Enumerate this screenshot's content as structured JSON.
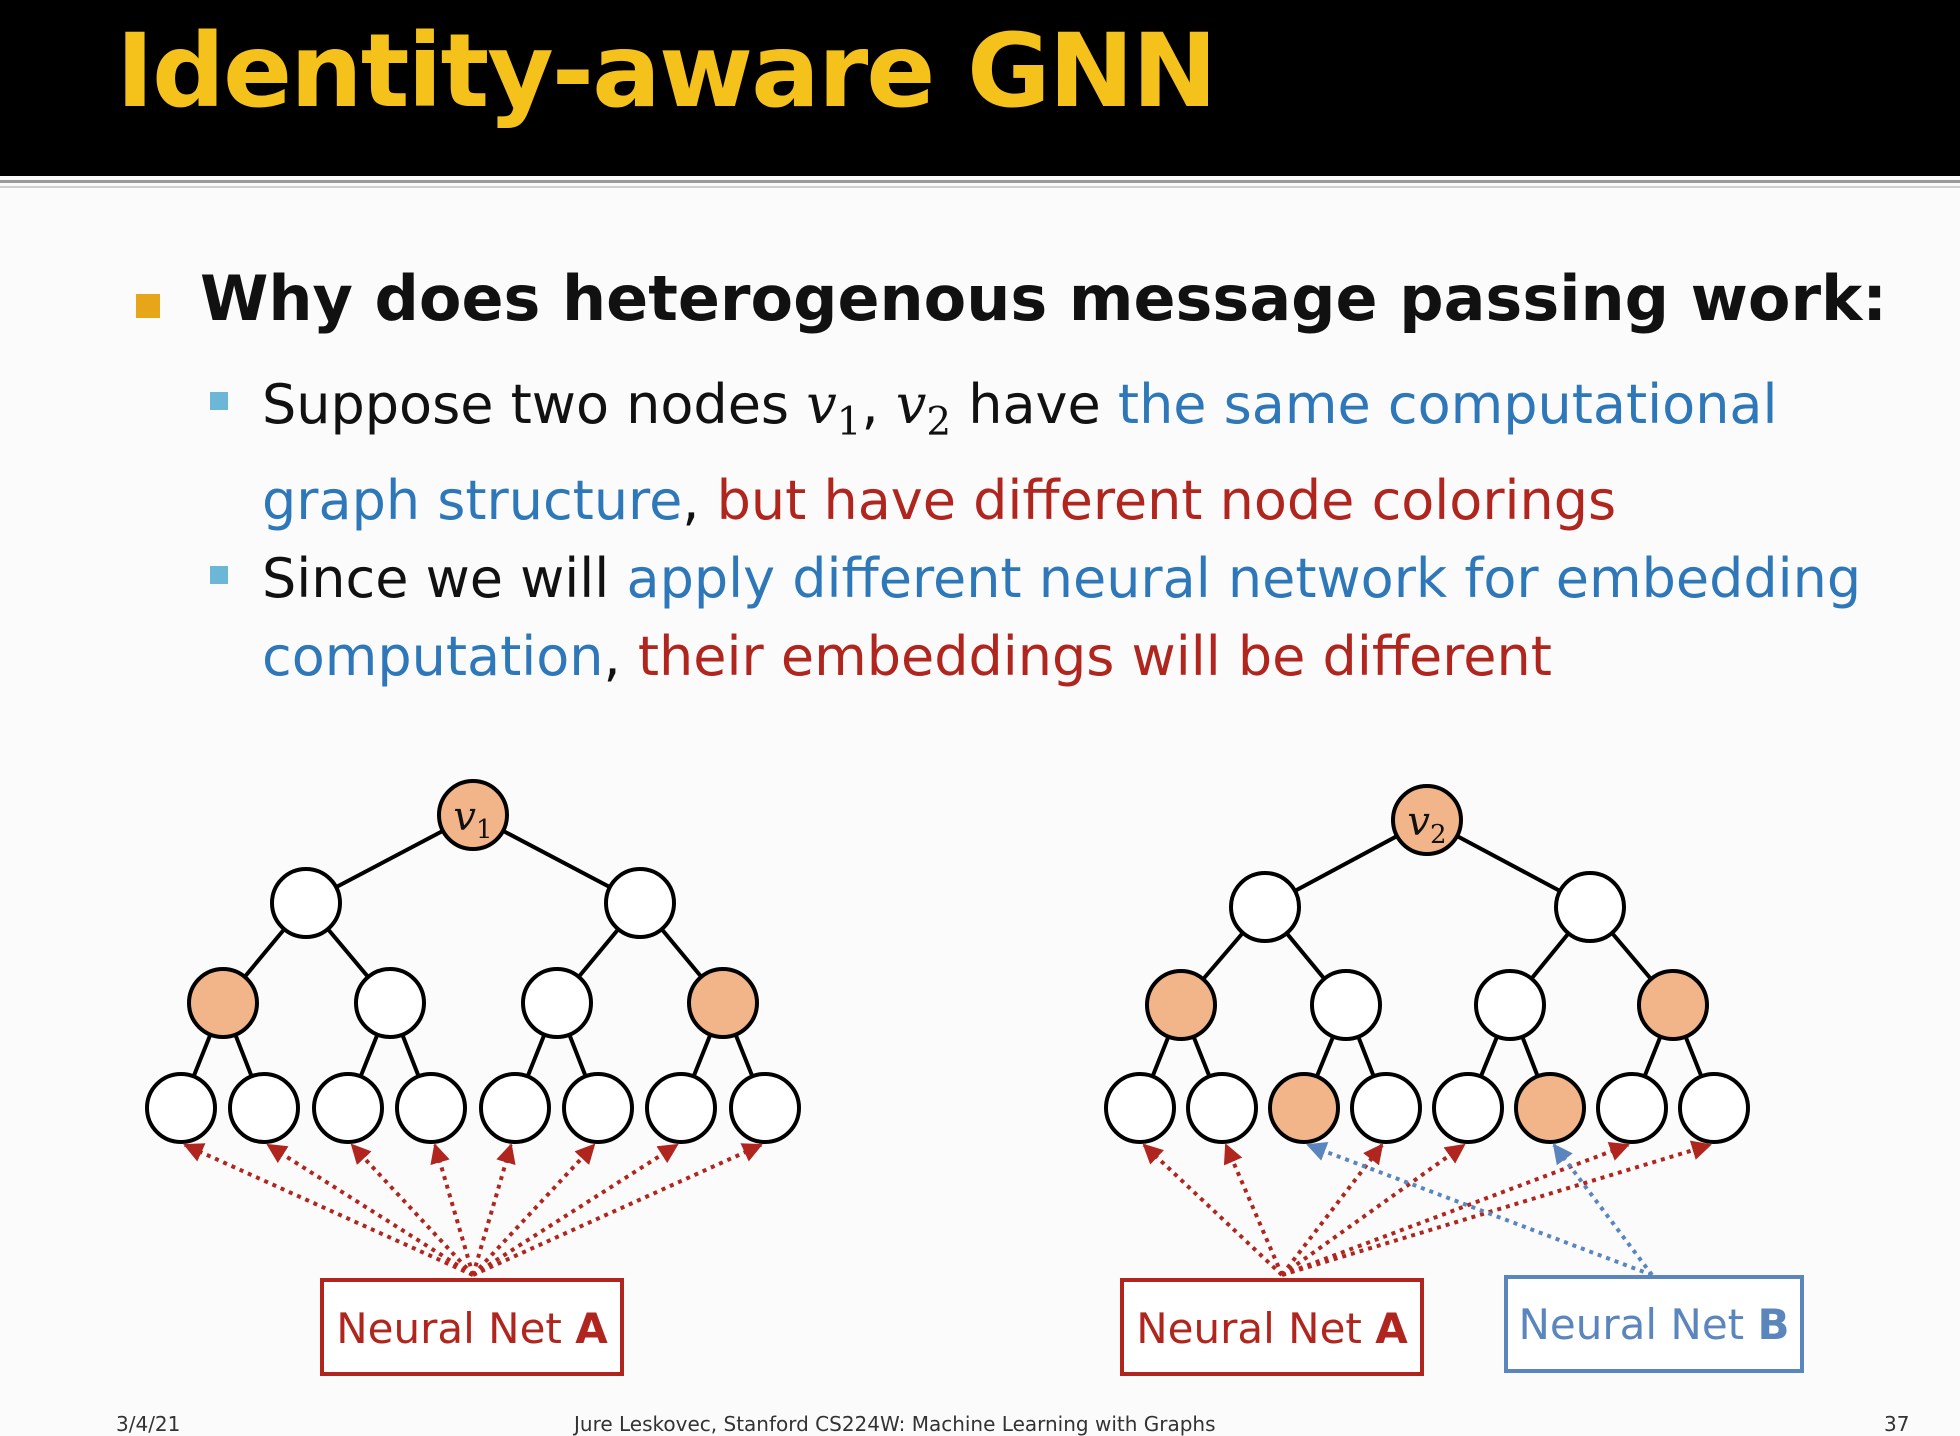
{
  "slide": {
    "title": "Identity-aware GNN",
    "bullet_main": "Why does heterogenous message passing work:",
    "sub1": {
      "p1": "Suppose two nodes ",
      "math_var": "v",
      "sub_1": "1",
      "sep": ", ",
      "sub_2": "2",
      "p2": " have ",
      "blue": "the same computational",
      "blue2": "graph structure",
      "comma": ",",
      "red": " but have different node colorings"
    },
    "sub2": {
      "p1": "Since we will ",
      "blue": "apply different neural network for embedding",
      "blue2": "computation",
      "comma": ",",
      "red": " their embeddings will be different"
    },
    "tree_left": {
      "root_var": "v",
      "root_sub": "1"
    },
    "tree_right": {
      "root_var": "v",
      "root_sub": "2"
    },
    "net_a_left": {
      "prefix": "Neural Net ",
      "letter": "A"
    },
    "net_a_right": {
      "prefix": "Neural Net ",
      "letter": "A"
    },
    "net_b": {
      "prefix": "Neural Net ",
      "letter": "B"
    },
    "footer": {
      "date": "3/4/21",
      "course": "Jure Leskovec, Stanford CS224W: Machine Learning with Graphs",
      "page": "37"
    },
    "colors": {
      "title": "#f5c21b",
      "highlight_node": "#f2b489",
      "red": "#b0261f",
      "blue": "#2e78b9",
      "box_b": "#5b85bd"
    }
  }
}
